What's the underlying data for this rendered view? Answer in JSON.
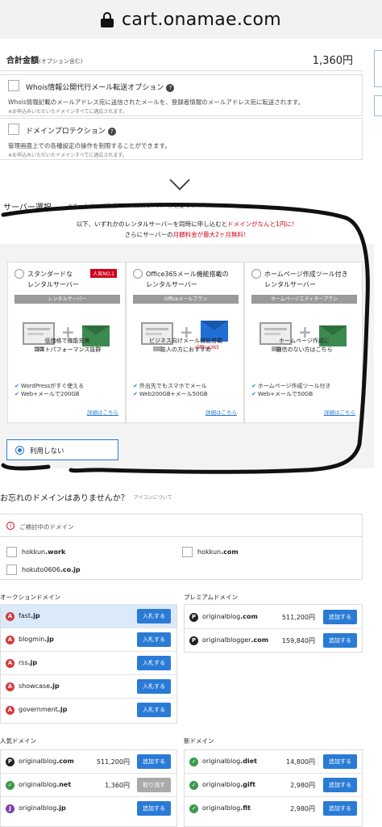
{
  "browser": {
    "url": "cart.onamae.com"
  },
  "total": {
    "label": "合計金額",
    "sub": "(オプション含む)",
    "value": "1,360円"
  },
  "whois": {
    "title": "Whois情報公開代行メール転送オプション",
    "desc": "Whois情報記載のメールアドレス宛に送信されたメールを、登録者情報のメールアドレス宛に転送されます。",
    "note": "※お申込みいただいたドメインすべてに適応されます。"
  },
  "protection": {
    "title": "ドメインプロテクション",
    "desc": "管理画面上での各種設定の操作を制限することができます。",
    "note": "※お申込みいただいたドメインすべてに適応されます。"
  },
  "server": {
    "heading": "サーバー選択",
    "note": "※ホームページ作成やメール…サーバーが必要です",
    "banner_1a": "以下、いずれかのレンタルサーバーを同時に申し込むと",
    "banner_1b": "ドメインがなんと1円に！",
    "banner_2a": "さらにサーバーの",
    "banner_2b": "月額料金が最大2ヶ月無料！",
    "cards": [
      {
        "title": "スタンダードな\nレンタルサーバー",
        "badge": "人気NO.1",
        "bar": "レンタルサーバー",
        "desc_1": "低価格で機能充実",
        "desc_2": "コストパフォーマンス抜群",
        "feat_1": "WordPressがすぐ使える",
        "feat_2": "Web+メールで200GB",
        "more": "詳細はこちら"
      },
      {
        "title": "Office365メール機能搭載の\nレンタルサーバー",
        "bar": "Officeメールプラン",
        "logo": "Office365",
        "desc_1": "ビジネス向けメール機能搭載",
        "desc_2": "法人の方におすすめ",
        "feat_1": "外出先でもスマホでメール",
        "feat_2": "Web200GB+メール50GB",
        "more": "詳細はこちら"
      },
      {
        "title": "ホームページ作成ツール付き\nレンタルサーバー",
        "bar": "ホームページエディタープラン",
        "desc_1": "ホームページ作成に",
        "desc_2": "自信のない方はこちら",
        "feat_1": "ホームページ作成ツール付き",
        "feat_2": "Web+メールで50GB",
        "more": "詳細はこちら"
      }
    ],
    "no_use": "利用しない"
  },
  "forgot": {
    "title": "お忘れのドメインはありませんか？",
    "help": "アイコンについて"
  },
  "pending": {
    "title": "ご検討中のドメイン",
    "items": [
      {
        "name": "hokkun",
        "tld": ".work"
      },
      {
        "name": "hokkun",
        "tld": ".com"
      },
      {
        "name": "hokuto0606",
        "tld": ".co.jp"
      }
    ]
  },
  "auction": {
    "title": "オークションドメイン",
    "btn": "入札する",
    "rows": [
      {
        "name": "fast",
        "tld": ".jp"
      },
      {
        "name": "blogmin",
        "tld": ".jp"
      },
      {
        "name": "rss",
        "tld": ".jp"
      },
      {
        "name": "showcase",
        "tld": ".jp"
      },
      {
        "name": "government",
        "tld": ".jp"
      }
    ]
  },
  "premium": {
    "title": "プレミアムドメイン",
    "btn": "追加する",
    "rows": [
      {
        "name": "originalblog",
        "tld": ".com",
        "price": "511,200円"
      },
      {
        "name": "originalblogger",
        "tld": ".com",
        "price": "159,840円"
      }
    ]
  },
  "popular": {
    "title": "人気ドメイン",
    "btn": "追加する",
    "btn_taken": "取り消す",
    "rows": [
      {
        "name": "originalblog",
        "tld": ".com",
        "price": "511,200円"
      },
      {
        "name": "originalblog",
        "tld": ".net",
        "price": "1,360円"
      },
      {
        "name": "originalblog",
        "tld": ".jp",
        "price": ""
      }
    ]
  },
  "newdom": {
    "title": "新ドメイン",
    "btn": "追加する",
    "rows": [
      {
        "name": "originalblog",
        "tld": ".diet",
        "price": "14,800円"
      },
      {
        "name": "originalblog",
        "tld": ".gift",
        "price": "2,980円"
      },
      {
        "name": "originalblog",
        "tld": ".fit",
        "price": "2,980円"
      }
    ]
  }
}
